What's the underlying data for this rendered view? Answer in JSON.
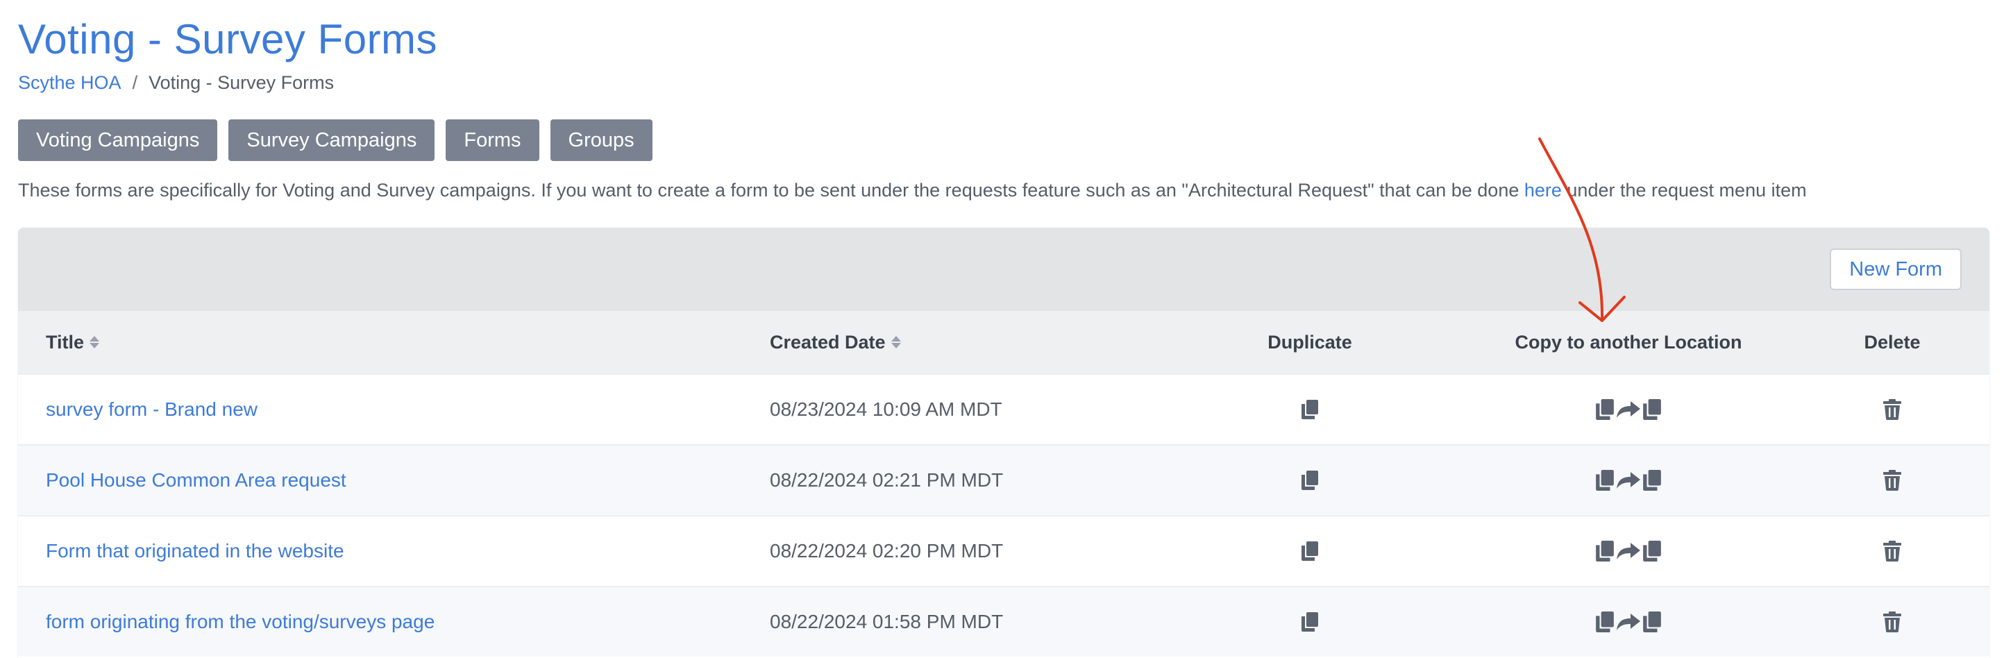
{
  "page": {
    "title": "Voting - Survey Forms"
  },
  "breadcrumb": {
    "home": "Scythe HOA",
    "separator": "/",
    "current": "Voting - Survey Forms"
  },
  "tabs": [
    {
      "label": "Voting Campaigns"
    },
    {
      "label": "Survey Campaigns"
    },
    {
      "label": "Forms"
    },
    {
      "label": "Groups"
    }
  ],
  "info": {
    "text_before": "These forms are specifically for Voting and Survey campaigns. If you want to create a form to be sent under the requests feature such as an \"Architectural Request\" that can be done ",
    "link": "here",
    "text_after": " under the request menu item"
  },
  "toolbar": {
    "new_form_label": "New Form"
  },
  "table": {
    "columns": {
      "title": "Title",
      "created_date": "Created Date",
      "duplicate": "Duplicate",
      "copy_location": "Copy to another Location",
      "delete": "Delete"
    },
    "rows": [
      {
        "title": "survey form - Brand new",
        "created": "08/23/2024 10:09 AM MDT"
      },
      {
        "title": "Pool House Common Area request",
        "created": "08/22/2024 02:21 PM MDT"
      },
      {
        "title": "Form that originated in the website",
        "created": "08/22/2024 02:20 PM MDT"
      },
      {
        "title": "form originating from the voting/surveys page",
        "created": "08/22/2024 01:58 PM MDT"
      }
    ]
  },
  "icons": {
    "duplicate": "copy-icon",
    "copy_location": "copy-share-copy-icon",
    "delete": "trash-icon",
    "sort": "sort-icon"
  },
  "colors": {
    "accent": "#3d7bd9",
    "tab_bg": "#7a8291",
    "toolbar_bg": "#e3e4e6",
    "annotation": "#e03a1e"
  }
}
